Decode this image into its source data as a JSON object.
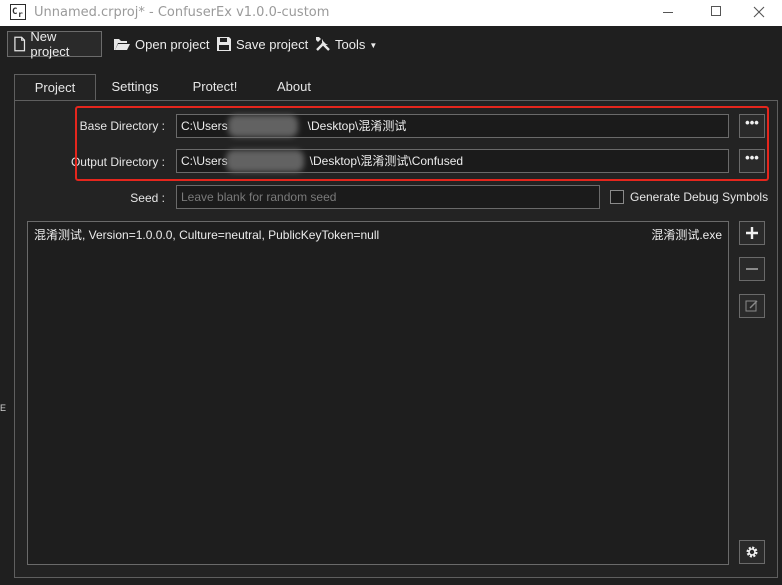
{
  "window": {
    "title": "Unnamed.crproj* - ConfuserEx v1.0.0-custom",
    "icon_letters": [
      "C",
      "r"
    ]
  },
  "toolbar": {
    "new_project": "New project",
    "open_project": "Open project",
    "save_project": "Save project",
    "tools": "Tools"
  },
  "tabs": [
    {
      "label": "Project",
      "active": true
    },
    {
      "label": "Settings",
      "active": false
    },
    {
      "label": "Protect!",
      "active": false
    },
    {
      "label": "About",
      "active": false
    }
  ],
  "project": {
    "base_directory_label": "Base Directory :",
    "base_directory_prefix": "C:\\Users",
    "base_directory_suffix": "\\Desktop\\混淆测试",
    "output_directory_label": "Output Directory :",
    "output_directory_prefix": "C:\\Users",
    "output_directory_suffix": "\\Desktop\\混淆测试\\Confused",
    "browse_label": "•••",
    "seed_label": "Seed :",
    "seed_placeholder": "Leave blank for random seed",
    "debug_symbols_label": "Generate Debug Symbols",
    "debug_symbols_checked": false
  },
  "modules": [
    {
      "name": "混淆测试, Version=1.0.0.0, Culture=neutral, PublicKeyToken=null",
      "file": "混淆测试.exe"
    }
  ],
  "side_buttons": [
    "plus-icon",
    "minus-icon",
    "edit-icon",
    "gear-icon"
  ],
  "edge_text": "E",
  "colors": {
    "background": "#1f1f1f",
    "panel": "#232323",
    "highlight": "#e5261d",
    "text": "#e6e6e6"
  }
}
